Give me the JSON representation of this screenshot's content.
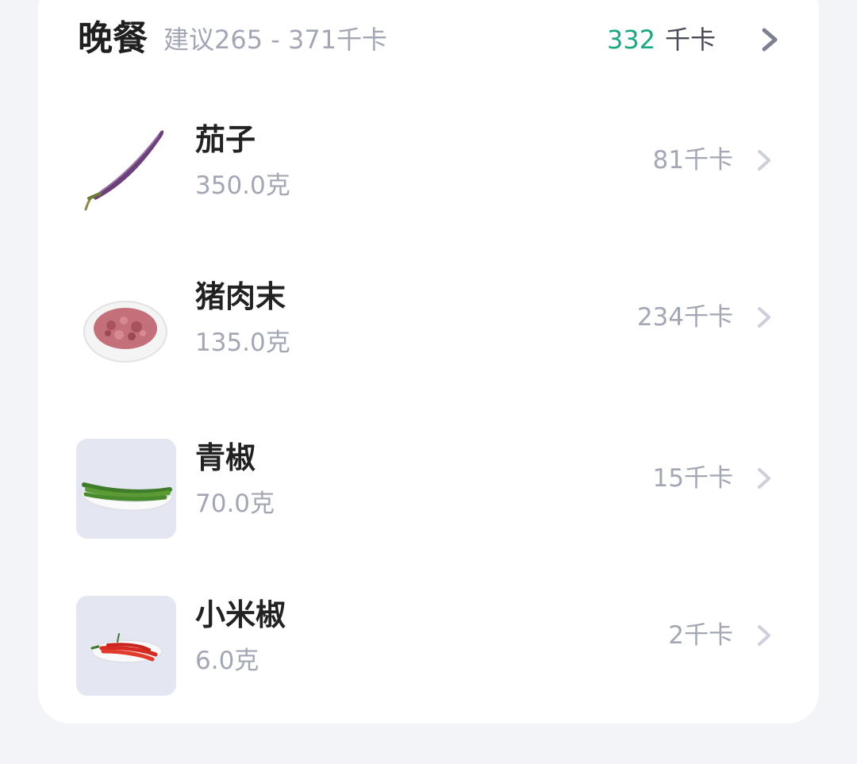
{
  "meal": {
    "title": "晚餐",
    "suggestion": "建议265 - 371千卡",
    "total_value": "332",
    "total_unit": "千卡"
  },
  "foods": [
    {
      "name": "茄子",
      "weight": "350.0克",
      "kcal": "81千卡",
      "image": "eggplant-image"
    },
    {
      "name": "猪肉末",
      "weight": "135.0克",
      "kcal": "234千卡",
      "image": "minced-pork-image"
    },
    {
      "name": "青椒",
      "weight": "70.0克",
      "kcal": "15千卡",
      "image": "green-pepper-image"
    },
    {
      "name": "小米椒",
      "weight": "6.0克",
      "kcal": "2千卡",
      "image": "red-chili-image"
    }
  ],
  "colors": {
    "accent_green": "#1aa782",
    "muted_text": "#a3a7b4",
    "background": "#f3f4f8"
  }
}
